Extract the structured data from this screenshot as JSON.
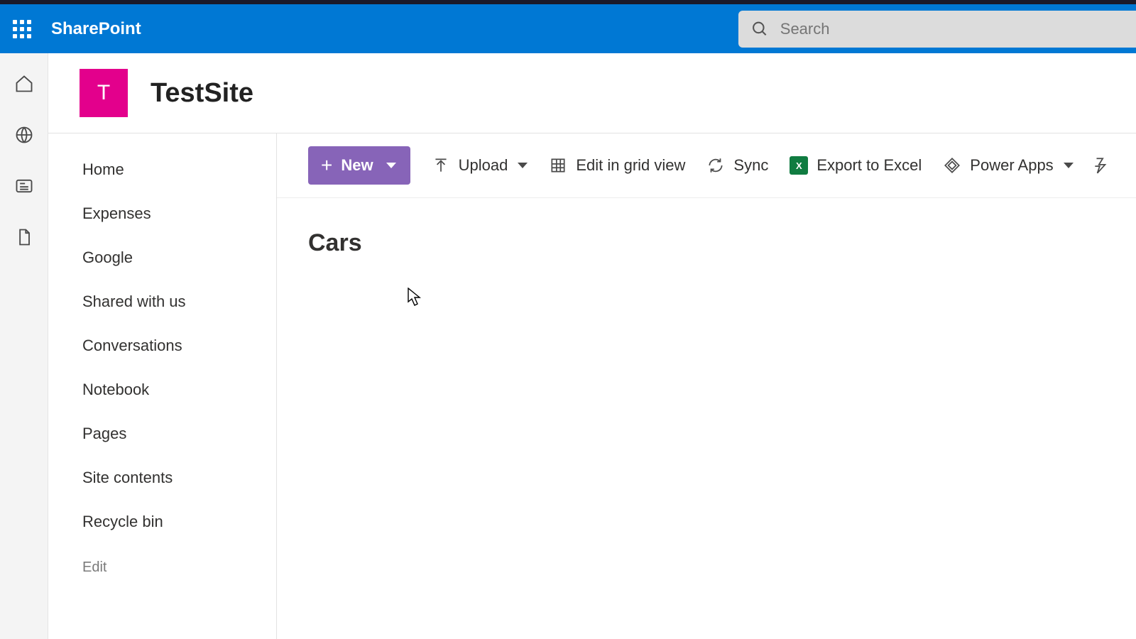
{
  "brand": "SharePoint",
  "search": {
    "placeholder": "Search"
  },
  "site": {
    "logo_letter": "T",
    "title": "TestSite"
  },
  "nav": {
    "items": [
      "Home",
      "Expenses",
      "Google",
      "Shared with us",
      "Conversations",
      "Notebook",
      "Pages",
      "Site contents",
      "Recycle bin"
    ],
    "edit_label": "Edit"
  },
  "toolbar": {
    "new_label": "New",
    "upload_label": "Upload",
    "edit_grid_label": "Edit in grid view",
    "sync_label": "Sync",
    "export_excel_label": "Export to Excel",
    "powerapps_label": "Power Apps"
  },
  "list": {
    "title": "Cars"
  }
}
